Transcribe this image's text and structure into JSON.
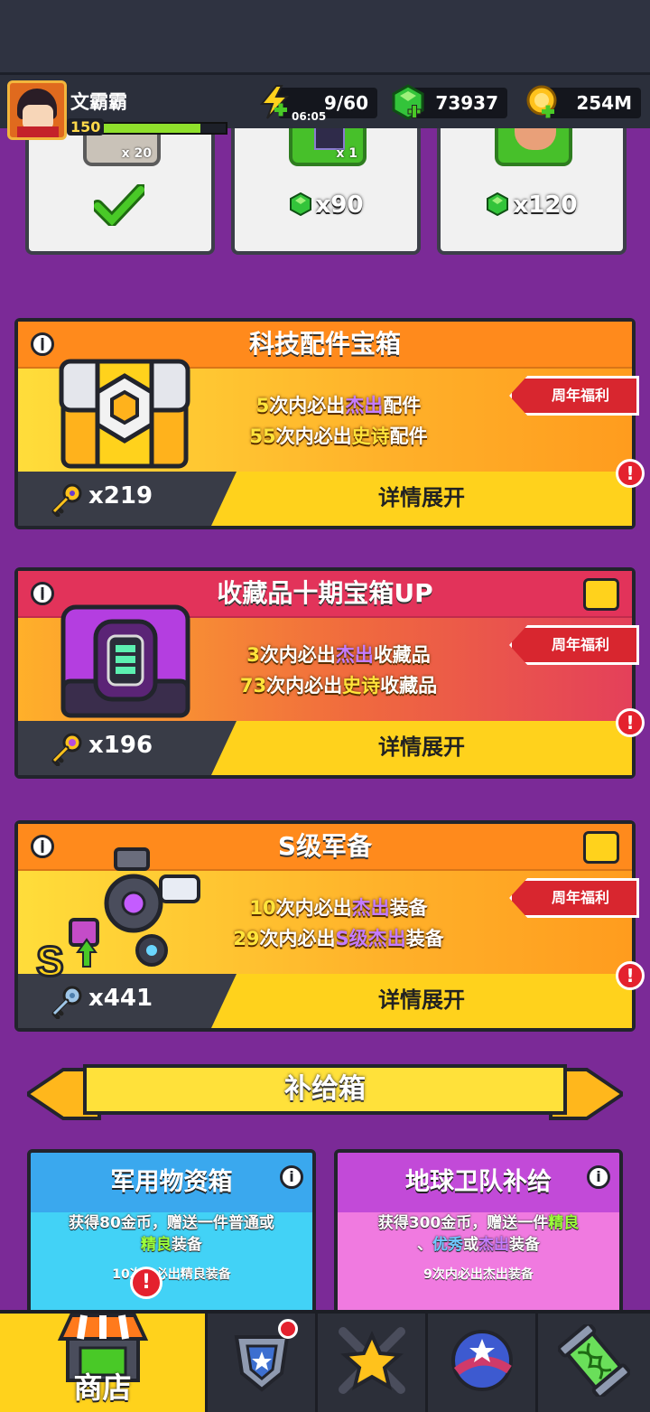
{
  "colors": {
    "background": "#7b2a97",
    "accent": "#ffd21c",
    "alert": "#e4212e",
    "tech_header": "#ff8a1c",
    "collect_header": "#e2335a",
    "s_header": "#ff8a1c"
  },
  "player": {
    "name": "文霸霸",
    "level": "150",
    "xp_fraction": 0.8
  },
  "resources": {
    "energy": "9/60",
    "energy_timer": "06:05",
    "gems": "73937",
    "gold": "254M"
  },
  "prev_offers": [
    {
      "qty": "x 20",
      "price": "",
      "claimed": true
    },
    {
      "qty": "x 1",
      "price": "x90",
      "claimed": false
    },
    {
      "qty": "",
      "price": "x120",
      "claimed": false
    }
  ],
  "chests": [
    {
      "title": "科技配件宝箱",
      "badge": "周年福利",
      "line1": {
        "n": "5",
        "a": "次内必出",
        "hl": "杰出",
        "b": "配件"
      },
      "line2": {
        "n": "55",
        "a": "次内必出",
        "hl": "史诗",
        "b": "配件"
      },
      "keys": "x219",
      "button": "详情展开",
      "icon": "tech-chest-icon"
    },
    {
      "title": "收藏品十期宝箱UP",
      "badge": "周年福利",
      "line1": {
        "n": "3",
        "a": "次内必出",
        "hl": "杰出",
        "b": "收藏品"
      },
      "line2": {
        "n": "73",
        "a": "次内必出",
        "hl": "史诗",
        "b": "收藏品"
      },
      "keys": "x196",
      "button": "详情展开",
      "icon": "collectible-chest-icon"
    },
    {
      "title": "S级军备",
      "badge": "周年福利",
      "line1": {
        "n": "10",
        "a": "次内必出",
        "hl": "杰出",
        "b": "装备"
      },
      "line2": {
        "n": "29",
        "a": "次内必出",
        "hl": "S级杰出",
        "b": "装备"
      },
      "keys": "x441",
      "button": "详情展开",
      "icon": "s-gear-icon"
    }
  ],
  "supply": {
    "title": "补给箱",
    "boxes": [
      {
        "title": "军用物资箱",
        "desc1": "获得80金币，赠送一件普通或",
        "desc2_hl": "精良",
        "desc2": "装备",
        "pity": "10次内必出精良装备"
      },
      {
        "title": "地球卫队补给",
        "desc1a": "获得300金币，赠送一件",
        "desc1_hl": "精良",
        "desc2_pre": "、",
        "desc2_hl1": "优秀",
        "desc2_mid": "或",
        "desc2_hl2": "杰出",
        "desc2": "装备",
        "pity": "9次内必出杰出装备"
      }
    ]
  },
  "nav": {
    "shop": "商店",
    "tabs": [
      "shop-tab",
      "guard-tab",
      "hero-tab",
      "planet-tab",
      "tech-tab"
    ]
  }
}
